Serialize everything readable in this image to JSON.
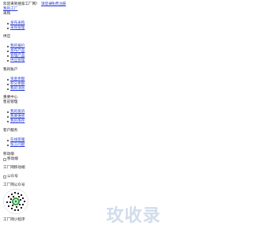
{
  "topbar": {
    "welcome": "欢迎来到搜索工厂网！",
    "login": "请登录",
    "register": "免费注册",
    "my_account": "我的工厂"
  },
  "sections": {
    "purchase": {
      "title": "采购",
      "items": [
        "发布采购",
        "采购管理"
      ]
    },
    "supply": {
      "title": "供应",
      "items": [
        "我的报价",
        "发布产品",
        "管理产品",
        "供应管理"
      ]
    },
    "account": {
      "title": "我的账户",
      "items": [
        "资金余额",
        "积分余额",
        "我的消息"
      ]
    },
    "help": {
      "title": "重要中心",
      "subtitle": "售前管理",
      "items": [
        "我的投诉",
        "我要维修",
        "我的库存"
      ]
    },
    "service": {
      "title": "客户服务",
      "items": [
        "在线客服",
        "留言问题"
      ]
    }
  },
  "mobile": {
    "title": "移动端",
    "img_alt_mobile": "移动端",
    "mobile_label": "工厂网移动端",
    "img_alt_wechat": "公众号",
    "wechat_label": "工厂网公众号",
    "miniprogram_label": "工厂网小程序"
  },
  "watermark_text": "玫收录",
  "colors": {
    "link": "#2b3fd6",
    "watermark": "#d1dcec"
  }
}
